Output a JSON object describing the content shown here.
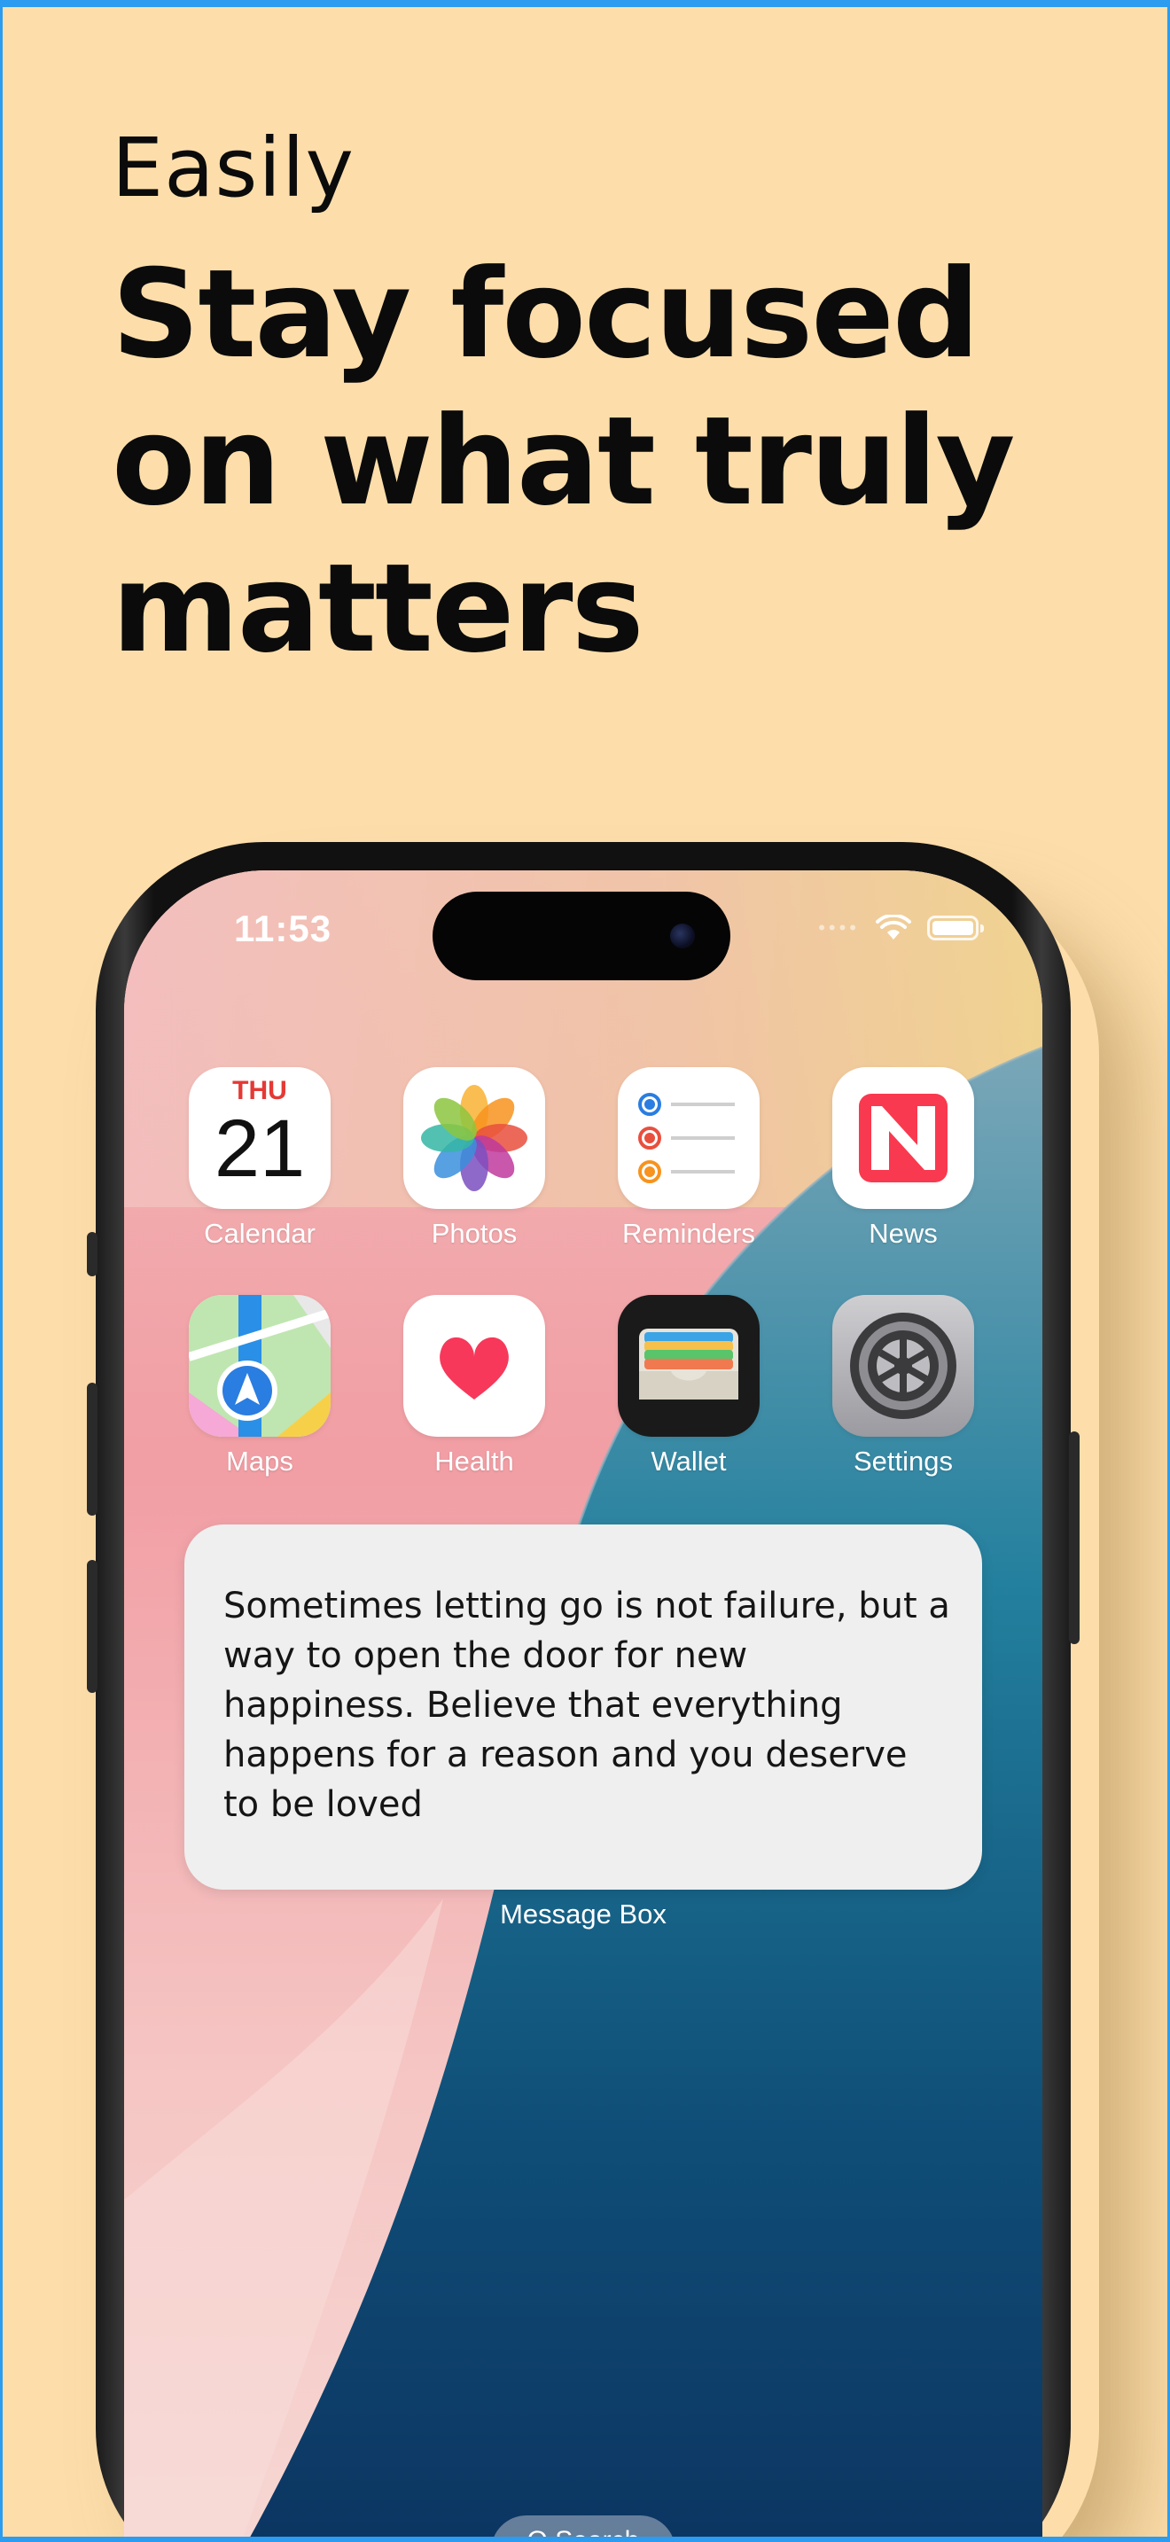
{
  "header": {
    "kicker": "Easily",
    "headline": "Stay focused on what truly matters"
  },
  "phone": {
    "status_time": "11:53",
    "apps": [
      {
        "label": "Calendar",
        "icon": "calendar-icon",
        "day": "THU",
        "date": "21"
      },
      {
        "label": "Photos",
        "icon": "photos-icon"
      },
      {
        "label": "Reminders",
        "icon": "reminders-icon"
      },
      {
        "label": "News",
        "icon": "news-icon"
      },
      {
        "label": "Maps",
        "icon": "maps-icon"
      },
      {
        "label": "Health",
        "icon": "health-icon"
      },
      {
        "label": "Wallet",
        "icon": "wallet-icon"
      },
      {
        "label": "Settings",
        "icon": "settings-icon"
      }
    ],
    "widget": {
      "quote": "Sometimes letting go is not failure, but a way to open the door for new happiness. Believe that everything happens for a reason and you deserve to be loved",
      "caption": "Message Box"
    },
    "search_label": "Q Search"
  },
  "colors": {
    "background": "#fddeab",
    "border_accent": "#2b9cf0",
    "widget_bg": "#efefef"
  }
}
